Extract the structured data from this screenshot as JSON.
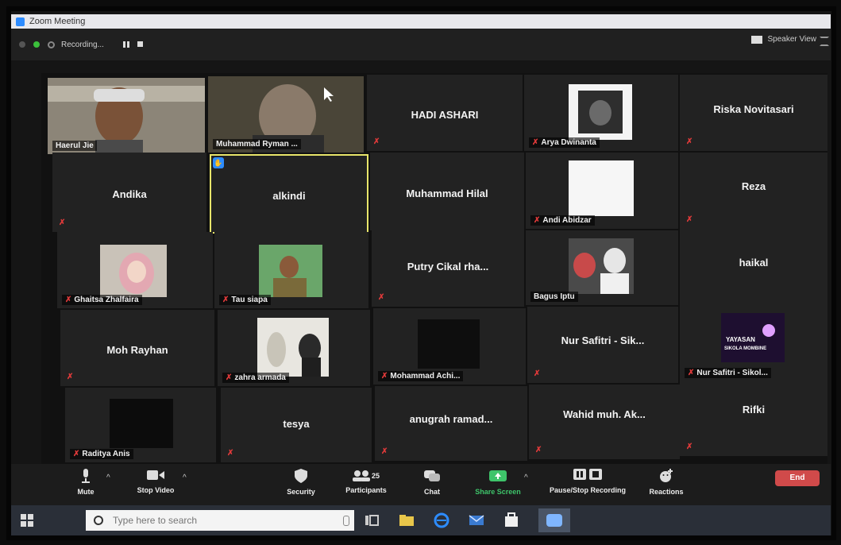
{
  "window": {
    "title": "Zoom Meeting"
  },
  "top_bar": {
    "recording": "Recording...",
    "speaker_view": "Speaker View"
  },
  "tiles": [
    {
      "name": "Haerul Jie",
      "muted": false,
      "video": "photo"
    },
    {
      "name": "Muhammad Ryman ...",
      "muted": false,
      "video": "photo"
    },
    {
      "name": "HADI ASHARI",
      "muted": true,
      "video": "none"
    },
    {
      "name": "Arya Dwinanta",
      "muted": true,
      "video": "thumb"
    },
    {
      "name": "Riska Novitasari",
      "muted": true,
      "video": "none"
    },
    {
      "name": "Andika",
      "muted": true,
      "video": "none"
    },
    {
      "name": "alkindi",
      "muted": false,
      "video": "none",
      "active": true
    },
    {
      "name": "Muhammad Hilal",
      "muted": false,
      "video": "none"
    },
    {
      "name": "Andi Abidzar",
      "muted": true,
      "video": "thumb"
    },
    {
      "name": "Reza",
      "muted": true,
      "video": "none"
    },
    {
      "name": "Ghaitsa Zhalfaira",
      "muted": true,
      "video": "thumb"
    },
    {
      "name": "Tau siapa",
      "muted": true,
      "video": "thumb"
    },
    {
      "name": "Putry Cikal rha...",
      "muted": true,
      "video": "none"
    },
    {
      "name": "Bagus Iptu",
      "muted": false,
      "video": "thumb"
    },
    {
      "name": "haikal",
      "muted": false,
      "video": "none"
    },
    {
      "name": "Moh Rayhan",
      "muted": true,
      "video": "none"
    },
    {
      "name": "zahra armada",
      "muted": true,
      "video": "thumb"
    },
    {
      "name": "Mohammad Achi...",
      "muted": true,
      "video": "thumb"
    },
    {
      "name": "Nur Safitri - Sik...",
      "muted": true,
      "video": "none"
    },
    {
      "name": "Nur Safitri - Sikol...",
      "muted": true,
      "video": "thumb"
    },
    {
      "name": "Raditya Anis",
      "muted": true,
      "video": "thumb"
    },
    {
      "name": "tesya",
      "muted": true,
      "video": "none"
    },
    {
      "name": "anugrah ramad...",
      "muted": true,
      "video": "none"
    },
    {
      "name": "Wahid muh. Ak...",
      "muted": true,
      "video": "none"
    },
    {
      "name": "Rifki",
      "muted": true,
      "video": "none"
    }
  ],
  "thumb_text": {
    "yayasan": "YAYASAN",
    "sikola": "SIKOLA MOMBINE"
  },
  "controls": {
    "mute": "Mute",
    "stop_video": "Stop Video",
    "security": "Security",
    "participants": "Participants",
    "participants_count": "25",
    "chat": "Chat",
    "share_screen": "Share Screen",
    "pause_recording": "Pause/Stop Recording",
    "reactions": "Reactions",
    "end": "End"
  },
  "taskbar": {
    "search_placeholder": "Type here to search"
  },
  "colors": {
    "accent": "#2d8cff",
    "active_border": "#e8e56a",
    "end": "#d04a4a",
    "muted": "#e03a3a"
  }
}
